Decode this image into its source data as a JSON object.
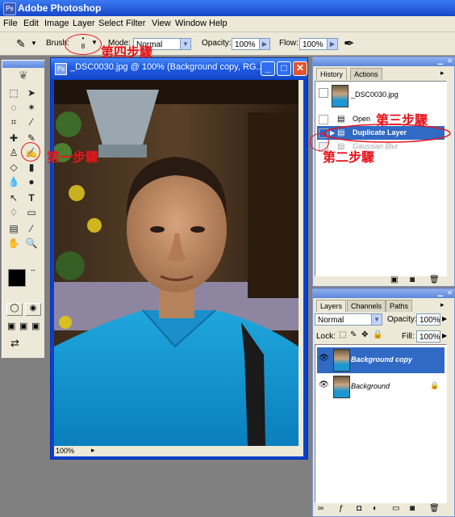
{
  "app": {
    "title": "Adobe Photoshop",
    "menu": [
      "File",
      "Edit",
      "Image",
      "Layer",
      "Select",
      "Filter",
      "View",
      "Window",
      "Help"
    ]
  },
  "options": {
    "brush_label": "Brush:",
    "brush_size": "8",
    "mode_label": "Mode:",
    "mode_value": "Normal",
    "opacity_label": "Opacity:",
    "opacity_value": "100%",
    "flow_label": "Flow:",
    "flow_value": "100%"
  },
  "document": {
    "title": "_DSC0030.jpg @ 100% (Background copy, RG...",
    "zoom": "100%"
  },
  "history": {
    "tabs": [
      "History",
      "Actions"
    ],
    "snapshot": "_DSC0030.jpg",
    "items": [
      {
        "label": "Open",
        "selected": false
      },
      {
        "label": "Duplicate Layer",
        "selected": true
      },
      {
        "label": "Gaussian Blur",
        "selected": false,
        "dimmed": true
      }
    ]
  },
  "layers": {
    "tabs": [
      "Layers",
      "Channels",
      "Paths"
    ],
    "blend_mode": "Normal",
    "opacity_label": "Opacity:",
    "opacity_value": "100%",
    "lock_label": "Lock:",
    "fill_label": "Fill:",
    "fill_value": "100%",
    "items": [
      {
        "name": "Background copy",
        "selected": true
      },
      {
        "name": "Background",
        "selected": false,
        "locked": true
      }
    ]
  },
  "annotations": {
    "step1": "第一步驟",
    "step2": "第二步驟",
    "step3": "第三步驟",
    "step4": "第四步驟"
  },
  "colors": {
    "annotation": "#e8141c",
    "selection": "#316ac5",
    "xp_title": "#1f5ee6"
  }
}
